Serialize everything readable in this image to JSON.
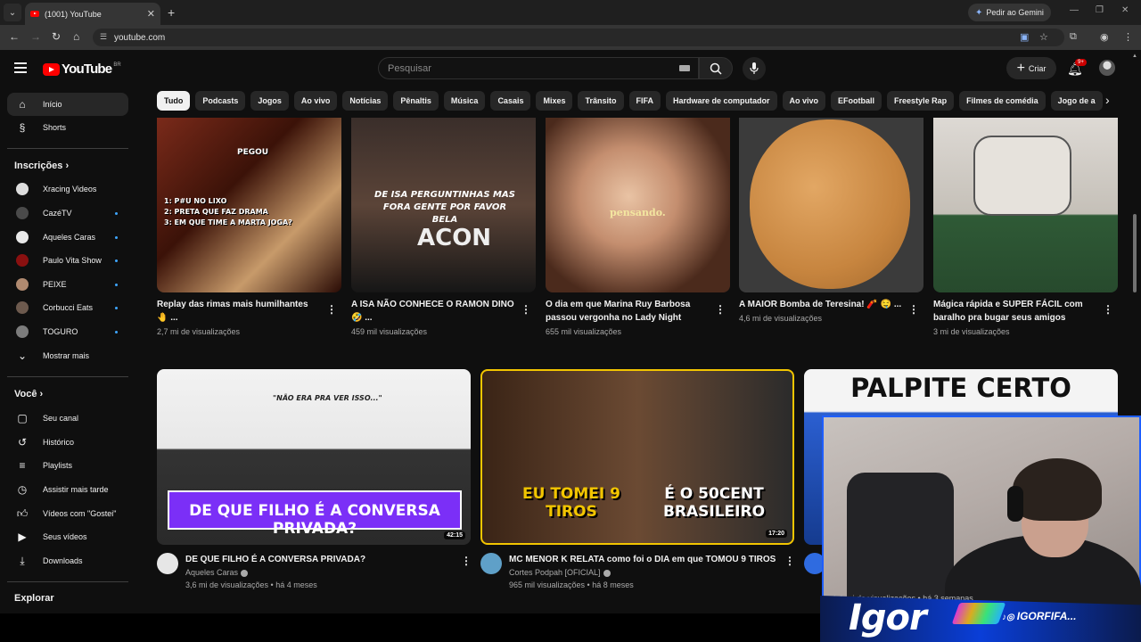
{
  "browser": {
    "tab_title": "(1001) YouTube",
    "url": "youtube.com",
    "gemini_label": "Pedir ao Gemini"
  },
  "masthead": {
    "logo_text": "YouTube",
    "country_code": "BR",
    "search_placeholder": "Pesquisar",
    "create_label": "Criar",
    "notification_count": "9+"
  },
  "sidebar": {
    "main": [
      {
        "label": "Início",
        "icon": "home-icon",
        "active": true
      },
      {
        "label": "Shorts",
        "icon": "shorts-icon",
        "active": false
      }
    ],
    "subscriptions_header": "Inscrições",
    "subscriptions": [
      {
        "label": "Xracing Videos",
        "dot": false
      },
      {
        "label": "CazéTV",
        "dot": true
      },
      {
        "label": "Aqueles Caras",
        "dot": true
      },
      {
        "label": "Paulo Vita Show",
        "dot": true
      },
      {
        "label": "PEIXE",
        "dot": true
      },
      {
        "label": "Corbucci Eats",
        "dot": true
      },
      {
        "label": "TOGURO",
        "dot": true
      }
    ],
    "show_more": "Mostrar mais",
    "you_header": "Você",
    "you": [
      {
        "label": "Seu canal",
        "icon": "channel-icon"
      },
      {
        "label": "Histórico",
        "icon": "history-icon"
      },
      {
        "label": "Playlists",
        "icon": "playlist-icon"
      },
      {
        "label": "Assistir mais tarde",
        "icon": "clock-icon"
      },
      {
        "label": "Vídeos com \"Gostei\"",
        "icon": "like-icon"
      },
      {
        "label": "Seus vídeos",
        "icon": "video-icon"
      },
      {
        "label": "Downloads",
        "icon": "download-icon"
      }
    ],
    "explore_header": "Explorar"
  },
  "chips": [
    "Tudo",
    "Podcasts",
    "Jogos",
    "Ao vivo",
    "Notícias",
    "Pênaltis",
    "Música",
    "Casais",
    "Mixes",
    "Trânsito",
    "FIFA",
    "Hardware de computador",
    "Ao vivo",
    "EFootball",
    "Freestyle Rap",
    "Filmes de comédia",
    "Jogo de a"
  ],
  "row1": [
    {
      "title": "Replay das rimas mais humilhantes 🤚 ...",
      "views": "2,7 mi de visualizações",
      "overlay": "1: P#U NO LIXO\n2: PRETA QUE FAZ DRAMA\n3: EM QUE TIME A MARTA JOGA?",
      "tag": "PEGOU"
    },
    {
      "title": "A ISA NÃO CONHECE O RAMON DINO 🤣 ...",
      "views": "459 mil visualizações",
      "overlay": "DE ISA PERGUNTINHAS MAS FORA GENTE POR FAVOR BELA",
      "tag": "ACON"
    },
    {
      "title": "O dia em que Marina Ruy Barbosa passou vergonha no Lady Night",
      "views": "655 mil visualizações",
      "overlay": "pensando."
    },
    {
      "title": "A MAIOR Bomba de Teresina! 🧨 🤤 ...",
      "views": "4,6 mi de visualizações"
    },
    {
      "title": "Mágica rápida e SUPER FÁCIL com baralho pra bugar seus amigos",
      "views": "3 mi de visualizações"
    }
  ],
  "row2": [
    {
      "title": "DE QUE FILHO É A CONVERSA PRIVADA?",
      "channel": "Aqueles Caras",
      "meta": "3,6 mi de visualizações • há 4 meses",
      "duration": "42:15",
      "overlay": "DE QUE FILHO É A CONVERSA PRIVADA?",
      "quote": "\"NÃO ERA PRA VER ISSO...\""
    },
    {
      "title": "MC MENOR K RELATA como foi o DIA em que TOMOU 9 TIROS",
      "channel": "Cortes Podpah [OFICIAL]",
      "meta": "965 mil visualizações • há 8 meses",
      "duration": "17:20",
      "overlay_left": "EU TOMEI 9 TIROS",
      "overlay_right": "É O 50CENT BRASILEIRO"
    },
    {
      "overlay": "PALPITE CERTO",
      "meta": "1,1 mi de visualizações • há 3 semanas"
    }
  ],
  "webcam": {
    "name": "Igor",
    "handle": "IGORFIFA..."
  },
  "colors": {
    "background": "#0f0f0f",
    "brand_red": "#ff0000",
    "dot_blue": "#3ea6ff",
    "webcam_blue": "#1e5eff"
  }
}
